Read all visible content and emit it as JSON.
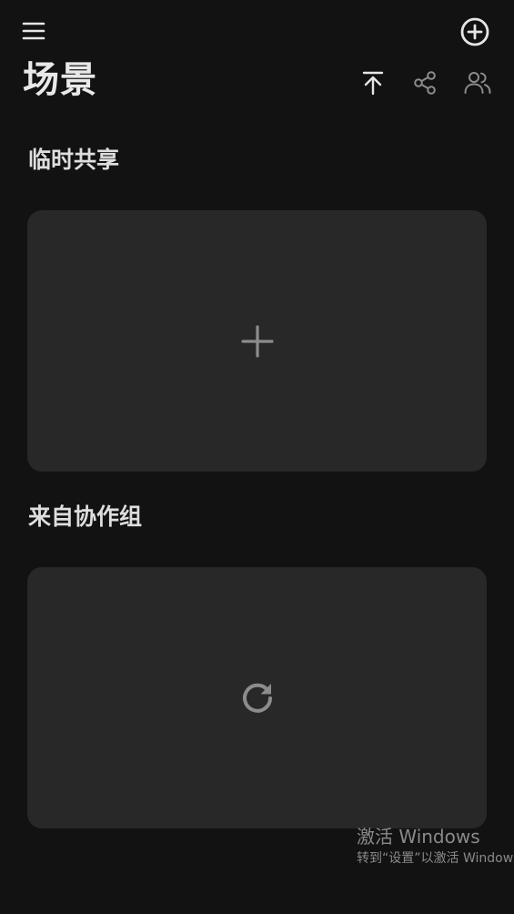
{
  "header": {
    "title": "场景",
    "menu_icon": "menu-icon",
    "add_icon": "plus-circle-icon",
    "toolbar_icons": [
      "arrow-up-to-top-icon",
      "share-icon",
      "users-icon"
    ]
  },
  "sections": [
    {
      "title": "临时共享",
      "card_icon": "plus-icon"
    },
    {
      "title": "来自协作组",
      "card_icon": "refresh-icon"
    }
  ],
  "watermark": {
    "title": "激活 Windows",
    "subtitle": "转到“设置”以激活 Windows。"
  },
  "colors": {
    "background": "#121212",
    "card": "#282828",
    "text": "#e6e6e6",
    "muted_icon": "#8c8c8c"
  }
}
